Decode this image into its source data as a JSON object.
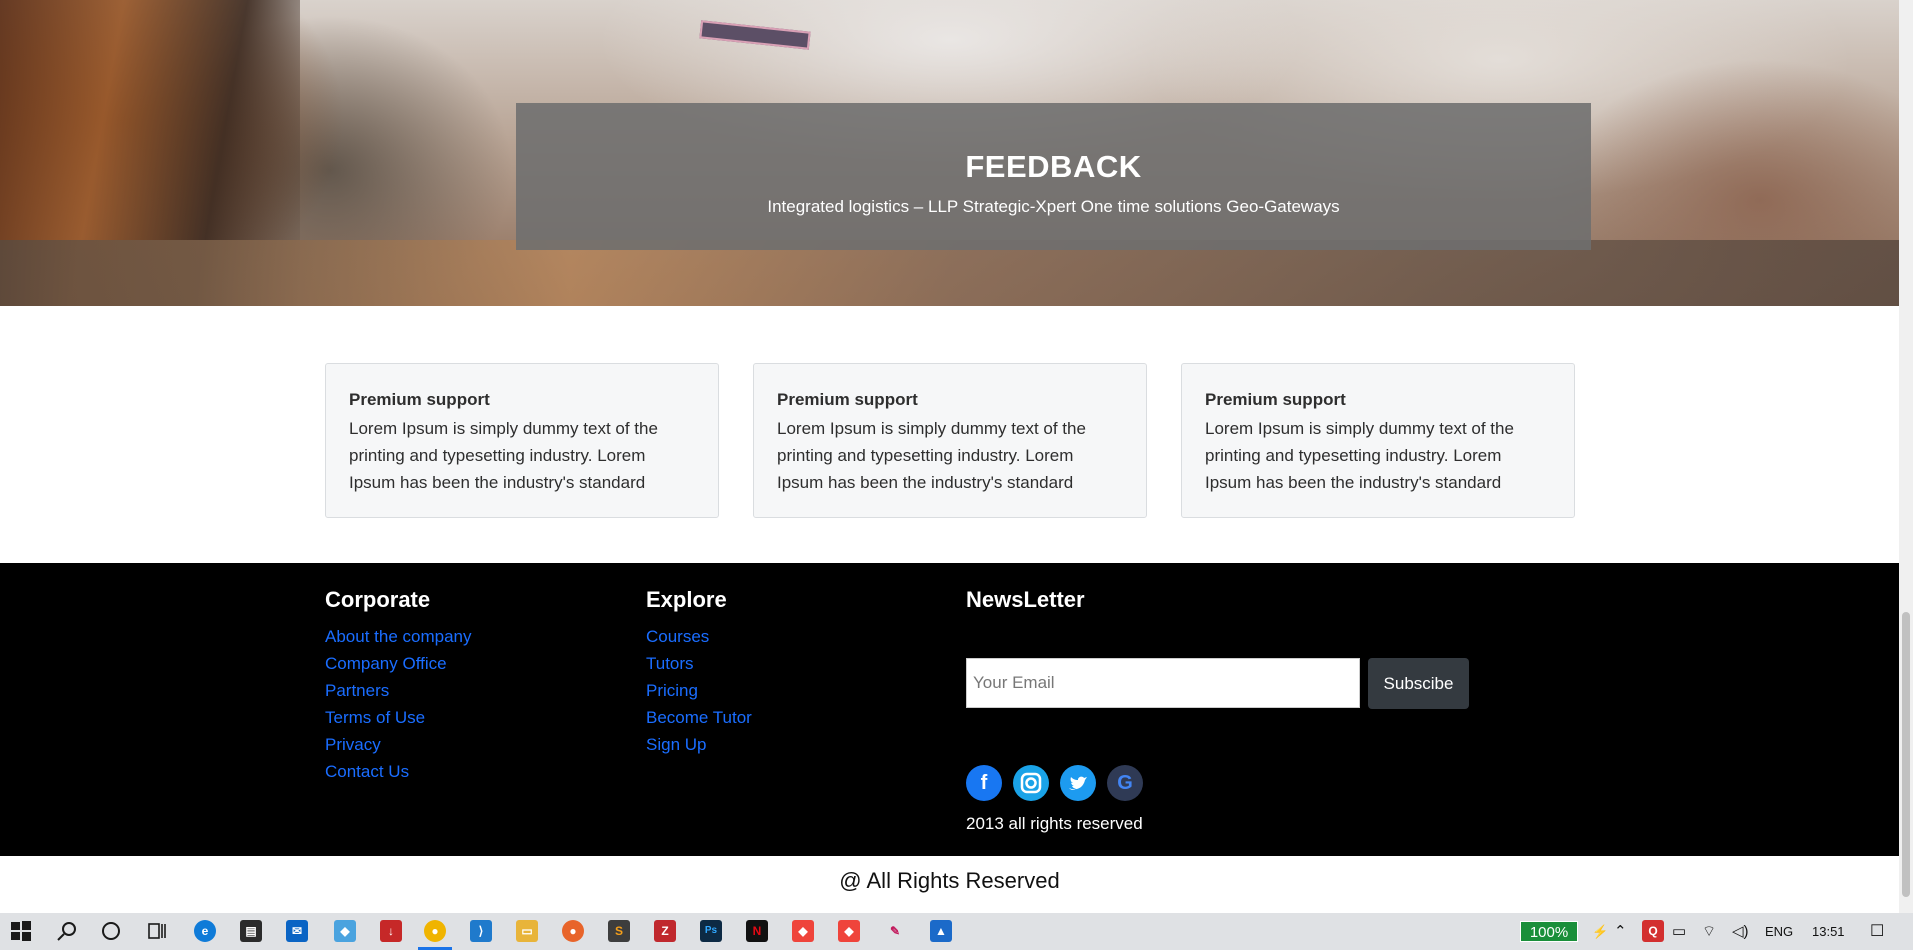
{
  "hero": {
    "title": "FEEDBACK",
    "subtitle": "Integrated logistics – LLP Strategic-Xpert One time solutions Geo-Gateways"
  },
  "cards": [
    {
      "title": "Premium support",
      "text": "Lorem Ipsum is simply dummy text of the printing and typesetting industry. Lorem Ipsum has been the industry's standard"
    },
    {
      "title": "Premium support",
      "text": "Lorem Ipsum is simply dummy text of the printing and typesetting industry. Lorem Ipsum has been the industry's standard"
    },
    {
      "title": "Premium support",
      "text": "Lorem Ipsum is simply dummy text of the printing and typesetting industry. Lorem Ipsum has been the industry's standard"
    }
  ],
  "footer": {
    "corporate": {
      "title": "Corporate",
      "links": [
        "About the company",
        "Company Office",
        "Partners",
        "Terms of Use",
        "Privacy",
        "Contact Us"
      ]
    },
    "explore": {
      "title": "Explore",
      "links": [
        "Courses",
        "Tutors",
        "Pricing",
        "Become Tutor",
        "Sign Up"
      ]
    },
    "newsletter": {
      "title": "NewsLetter",
      "email_placeholder": "Your Email",
      "subscribe_label": "Subscibe",
      "social_icons": [
        "facebook-icon",
        "instagram-icon",
        "twitter-icon",
        "google-icon"
      ],
      "copyright": "2013 all rights reserved"
    },
    "link_color": "#1a6dff"
  },
  "bottom_rights": "@ All Rights Reserved",
  "taskbar": {
    "icons": [
      "windows-start-icon",
      "search-icon",
      "cortana-icon",
      "task-view-icon",
      "edge-icon",
      "store-icon",
      "mail-icon",
      "app-icon",
      "downloader-icon",
      "chrome-icon",
      "vscode-icon",
      "file-explorer-icon",
      "firefox-icon",
      "sublime-icon",
      "filezilla-icon",
      "photoshop-icon",
      "netflix-icon",
      "anydesk-icon",
      "anydesk-icon-2",
      "paint-icon",
      "photos-icon"
    ],
    "battery": "100%",
    "language": "ENG",
    "time": "13:51"
  }
}
